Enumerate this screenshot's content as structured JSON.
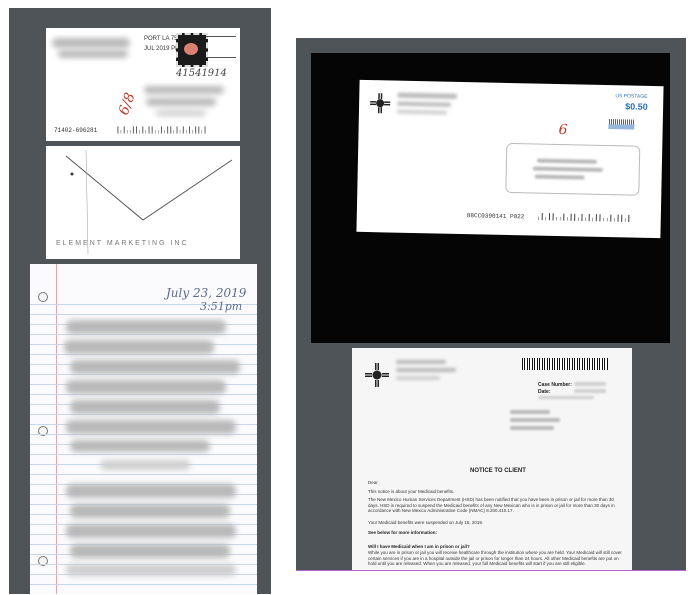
{
  "postcard": {
    "postmark_text": "PORT LA 750",
    "postmark_date": "JUL 2019 PM 2 L",
    "handwritten_number": "41541914",
    "red_mark": "6/8",
    "barcode_number": "71402-696281"
  },
  "envelope_back": {
    "bottom_text": "ELEMENT MARKETING INC"
  },
  "letter": {
    "date_line1": "July 23, 2019",
    "date_line2": "3:51pm"
  },
  "mailed_envelope": {
    "postage": "$0.50",
    "postage_label": "US POSTAGE",
    "red_mark": "6",
    "code": "88CC0390141 P022"
  },
  "notice": {
    "case_number_label": "Case Number:",
    "date_label": "Date:",
    "title": "NOTICE TO CLIENT",
    "dear": "Dear",
    "para1": "This notice is about your Medicaid benefits.",
    "para2": "The New Mexico Human Services Department (HSD) has been notified that you have been in prison or jail for more than 30 days. HSD is required to suspend the Medicaid benefits of any New Mexican who is in prison or jail for more than 30 days in accordance with New Mexico Administrative Code (NMAC) 8.200.410.17.",
    "para3": "Your Medicaid benefits were suspended on July 15, 2019.",
    "see_below": "See below for more information:",
    "question": "Will I have Medicaid when I am in prison or jail?",
    "para4": "While you are in prison or jail you will receive healthcare through the institution where you are held. Your Medicaid will still cover certain services if you are in a hospital outside the jail or prison for longer than 24 hours. All other Medicaid benefits are put on hold until you are released. When you are released, your full Medicaid benefits will start if you are still eligible."
  }
}
